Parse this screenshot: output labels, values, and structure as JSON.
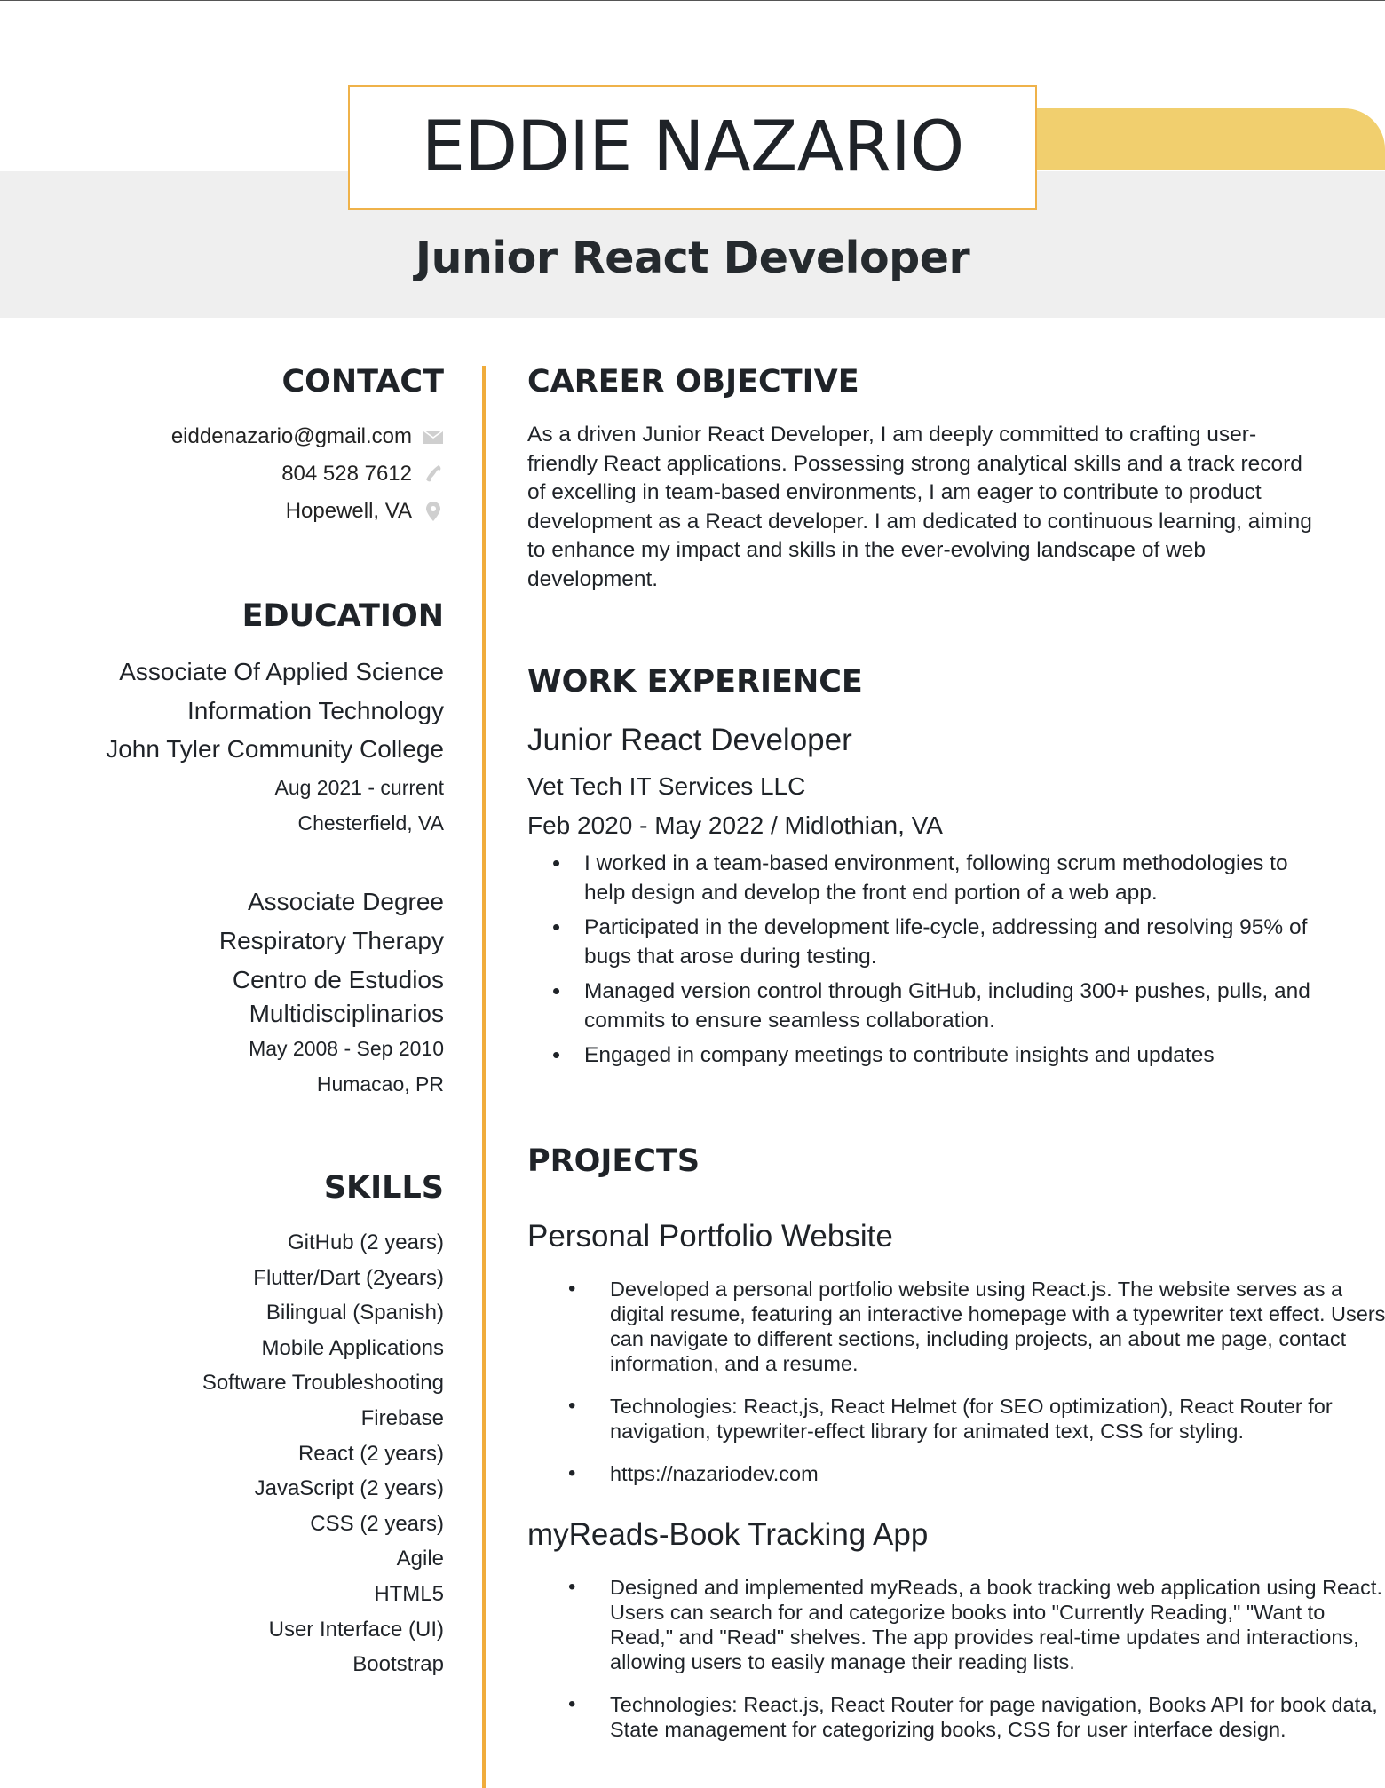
{
  "header": {
    "name": "EDDIE NAZARIO",
    "title": "Junior React Developer"
  },
  "colors": {
    "accent_yellow": "#f1cf6e",
    "accent_orange": "#f0ac3c",
    "band_gray": "#efefef"
  },
  "contact": {
    "heading": "CONTACT",
    "email": "eiddenazario@gmail.com",
    "phone": "804 528 7612",
    "location": "Hopewell, VA",
    "icons": [
      "envelope-icon",
      "phone-icon",
      "map-pin-icon"
    ]
  },
  "education": {
    "heading": "EDUCATION",
    "entries": [
      {
        "degree": "Associate Of Applied Science",
        "field": "Information  Technology",
        "school": "John Tyler Community College",
        "dates": "Aug 2021 - current",
        "location": "Chesterfield,  VA"
      },
      {
        "degree": "Associate Degree",
        "field": "Respiratory Therapy",
        "school_line1": "Centro de Estudios",
        "school_line2": "Multidisciplinarios",
        "dates": "May 2008 - Sep 2010",
        "location": "Humacao, PR"
      }
    ]
  },
  "skills": {
    "heading": "SKILLS",
    "items": [
      "GitHub (2 years)",
      "Flutter/Dart (2years)",
      "Bilingual (Spanish)",
      "Mobile Applications",
      "Software Troubleshooting",
      "Firebase",
      "React (2 years)",
      "JavaScript (2 years)",
      "CSS (2 years)",
      "Agile",
      "HTML5",
      "User Interface (UI)",
      "Bootstrap"
    ]
  },
  "objective": {
    "heading": "CAREER OBJECTIVE",
    "text": "As a driven Junior React Developer, I am deeply committed to crafting user-friendly React applications. Possessing strong analytical skills and a track record of excelling in team-based environments, I am eager to contribute to product development as a React developer. I am dedicated to continuous learning, aiming to enhance my impact and skills in the ever-evolving landscape of web development."
  },
  "experience": {
    "heading": "WORK EXPERIENCE",
    "role": "Junior React Developer",
    "company": "Vet Tech IT Services LLC",
    "dates_location": "Feb 2020 - May 2022  /  Midlothian, VA",
    "bullets": [
      "I worked in a team-based environment, following scrum methodologies to help design and develop the front end portion of a web app.",
      "Participated in the development life-cycle, addressing and resolving 95% of bugs that arose during testing.",
      "Managed version control through GitHub, including 300+ pushes, pulls, and commits to ensure seamless collaboration.",
      "Engaged in company meetings to contribute insights and updates"
    ]
  },
  "projects": {
    "heading": "PROJECTS",
    "items": [
      {
        "title": "Personal Portfolio Website",
        "bullets": [
          "Developed a personal portfolio website using React.js. The website serves as a digital resume, featuring an interactive homepage with a typewriter text effect. Users can navigate to different sections, including projects, an about me page, contact information, and a resume.",
          "Technologies: React,js, React Helmet (for SEO optimization), React Router for navigation, typewriter-effect library for animated text, CSS for styling.",
          "https://nazariodev.com"
        ]
      },
      {
        "title": "myReads-Book Tracking App",
        "bullets": [
          "Designed and implemented myReads, a book tracking web application using React. Users can search for and categorize books into \"Currently Reading,\" \"Want to Read,\" and \"Read\" shelves. The app provides real-time updates and interactions, allowing users to easily manage their reading lists.",
          "Technologies: React.js, React Router for page navigation, Books API for book data, State management for categorizing books, CSS for user interface design."
        ]
      }
    ]
  }
}
